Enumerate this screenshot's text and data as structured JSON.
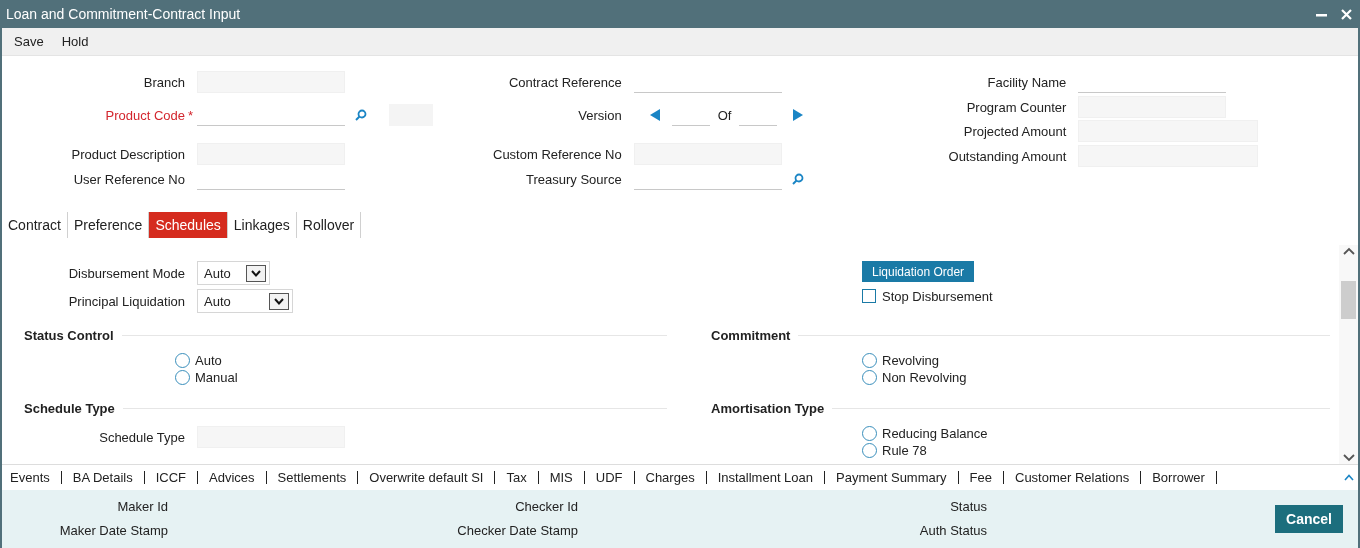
{
  "window": {
    "title": "Loan and Commitment-Contract Input"
  },
  "menu": [
    "Save",
    "Hold"
  ],
  "header": {
    "columns": [
      [
        {
          "kind": "readonly",
          "label": "Branch"
        },
        {
          "kind": "input",
          "label": "Product Code",
          "required": true,
          "required_mark": "*",
          "lookup": true,
          "extra": true
        },
        {
          "kind": "readonly",
          "label": "Product Description"
        },
        {
          "kind": "input",
          "label": "User Reference No"
        }
      ],
      [
        {
          "kind": "input",
          "label": "Contract Reference"
        },
        {
          "kind": "version",
          "label": "Version",
          "of_label": "Of"
        },
        {
          "kind": "readonly",
          "label": "Custom Reference No"
        },
        {
          "kind": "input",
          "label": "Treasury Source",
          "lookup": true
        }
      ],
      [
        {
          "kind": "input",
          "label": "Facility Name"
        },
        {
          "kind": "readonly",
          "label": "Program Counter"
        },
        {
          "kind": "readonly",
          "label": "Projected Amount"
        },
        {
          "kind": "readonly",
          "label": "Outstanding Amount"
        }
      ]
    ]
  },
  "tabs": [
    {
      "label": "Contract",
      "selected": false
    },
    {
      "label": "Preference",
      "selected": false
    },
    {
      "label": "Schedules",
      "selected": true
    },
    {
      "label": "Linkages",
      "selected": false
    },
    {
      "label": "Rollover",
      "selected": false
    }
  ],
  "schedules": {
    "selects": [
      {
        "label": "Disbursement Mode",
        "value": "Auto"
      },
      {
        "label": "Principal Liquidation",
        "value": "Auto"
      }
    ],
    "button": "Liquidation Order",
    "checkbox": {
      "label": "Stop Disbursement",
      "checked": false
    },
    "sections": [
      [
        {
          "title": "Status Control",
          "items": [
            {
              "kind": "radio",
              "label": "Auto",
              "selected": false
            },
            {
              "kind": "radio",
              "label": "Manual",
              "selected": false
            }
          ]
        },
        {
          "title": "Commitment",
          "items": [
            {
              "kind": "radio",
              "label": "Revolving",
              "selected": false
            },
            {
              "kind": "radio",
              "label": "Non Revolving",
              "selected": false
            }
          ]
        }
      ],
      [
        {
          "title": "Schedule Type",
          "items": [
            {
              "kind": "field",
              "label": "Schedule Type"
            }
          ]
        },
        {
          "title": "Amortisation Type",
          "items": [
            {
              "kind": "radio",
              "label": "Reducing Balance",
              "selected": false
            },
            {
              "kind": "radio",
              "label": "Rule 78",
              "selected": false
            }
          ]
        }
      ]
    ]
  },
  "subsystems": [
    "Events",
    "BA Details",
    "ICCF",
    "Advices",
    "Settlements",
    "Overwrite default SI",
    "Tax",
    "MIS",
    "UDF",
    "Charges",
    "Installment Loan",
    "Payment Summary",
    "Fee",
    "Customer Relations",
    "Borrower"
  ],
  "audit": [
    [
      {
        "label": "Maker Id"
      },
      {
        "label": "Maker Date Stamp"
      }
    ],
    [
      {
        "label": "Checker Id"
      },
      {
        "label": "Checker Date Stamp"
      }
    ],
    [
      {
        "label": "Status"
      },
      {
        "label": "Auth Status"
      }
    ]
  ],
  "cancel": "Cancel"
}
